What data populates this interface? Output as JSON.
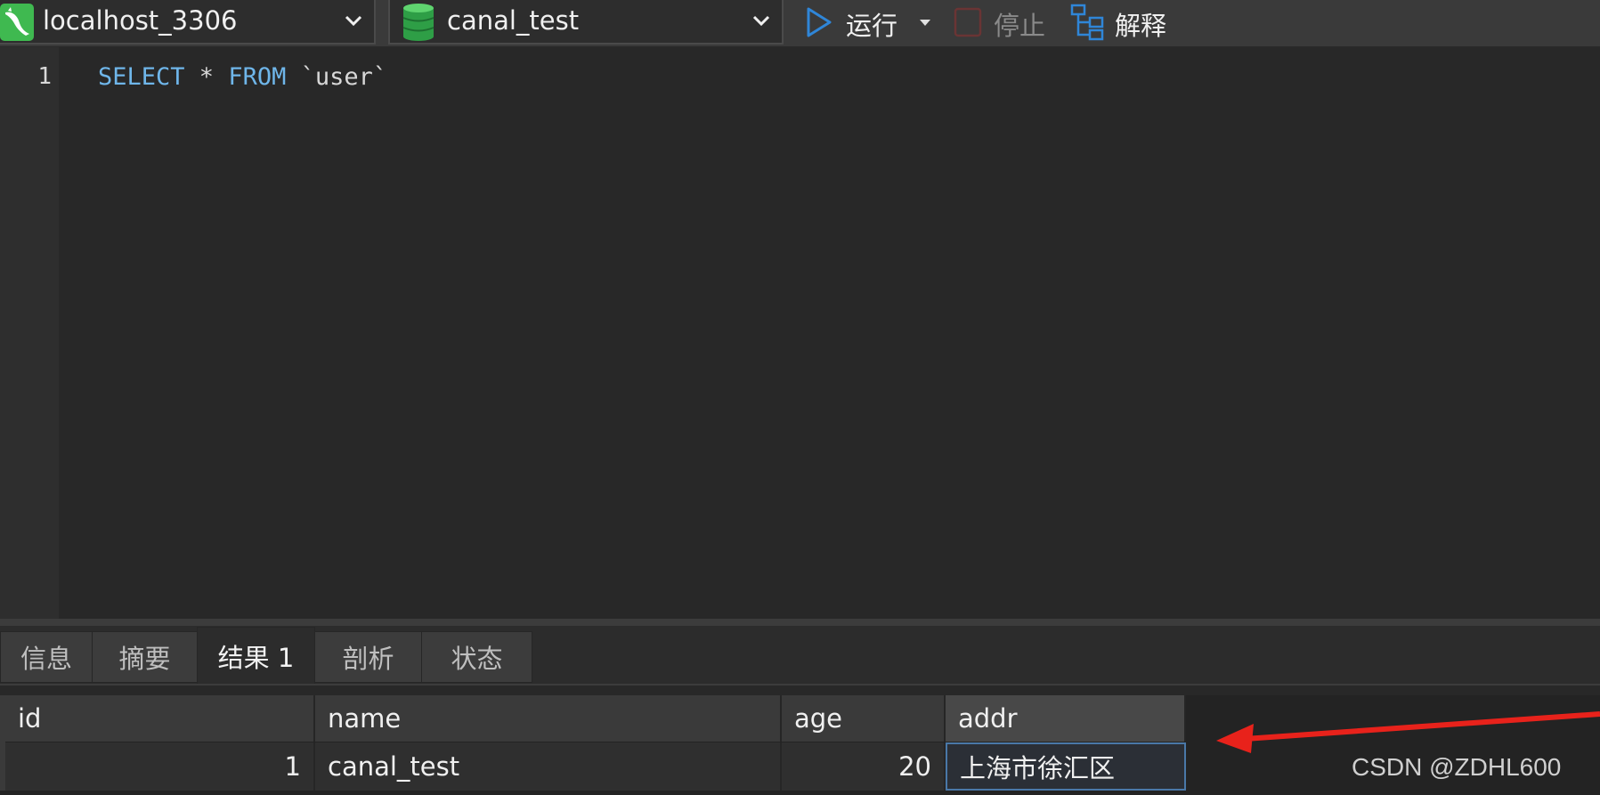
{
  "toolbar": {
    "connection": {
      "label": "localhost_3306",
      "icon": "mysql-dolphin-icon"
    },
    "database": {
      "label": "canal_test",
      "icon": "database-icon"
    },
    "run": {
      "label": "运行",
      "icon": "play-icon"
    },
    "stop": {
      "label": "停止",
      "icon": "stop-icon"
    },
    "explain": {
      "label": "解释",
      "icon": "explain-icon"
    }
  },
  "editor": {
    "lines": [
      {
        "number": "1",
        "tokens": [
          "SELECT",
          " * ",
          "FROM",
          " `user`"
        ]
      }
    ]
  },
  "result_tabs": [
    {
      "label": "信息",
      "active": false
    },
    {
      "label": "摘要",
      "active": false
    },
    {
      "label": "结果 1",
      "active": true
    },
    {
      "label": "剖析",
      "active": false
    },
    {
      "label": "状态",
      "active": false
    }
  ],
  "grid": {
    "columns": [
      "id",
      "name",
      "age",
      "addr"
    ],
    "rows": [
      [
        "1",
        "canal_test",
        "20",
        "上海市徐汇区"
      ]
    ]
  },
  "annotation": {
    "arrow_color": "#e8221b"
  },
  "watermark": "CSDN @ZDHL600",
  "colors": {
    "keyword": "#6fb6ea",
    "background": "#282828",
    "accent": "#2f86d8"
  }
}
